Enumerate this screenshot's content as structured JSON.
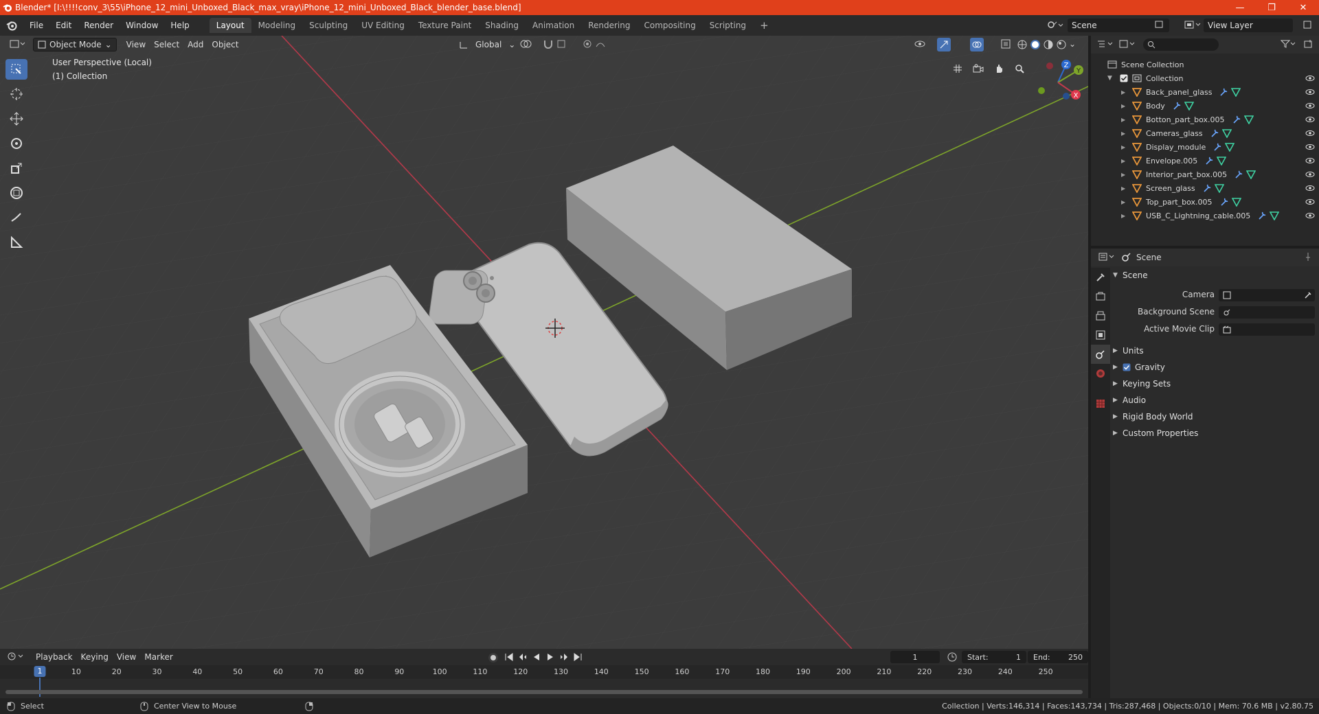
{
  "titlebar": {
    "title": "Blender* [I:\\!!!!conv_3\\55\\iPhone_12_mini_Unboxed_Black_max_vray\\iPhone_12_mini_Unboxed_Black_blender_base.blend]",
    "minimize": "—",
    "maximize": "❐",
    "close": "✕"
  },
  "menu": [
    "File",
    "Edit",
    "Render",
    "Window",
    "Help"
  ],
  "workspaces": [
    "Layout",
    "Modeling",
    "Sculpting",
    "UV Editing",
    "Texture Paint",
    "Shading",
    "Animation",
    "Rendering",
    "Compositing",
    "Scripting"
  ],
  "workspace_add": "+",
  "scene_name": "Scene",
  "view_layer": "View Layer",
  "viewport": {
    "mode": "Object Mode",
    "menus": [
      "View",
      "Select",
      "Add",
      "Object"
    ],
    "orientation": "Global",
    "info_line1": "User Perspective (Local)",
    "info_line2": "(1) Collection"
  },
  "gizmo": {
    "x": "X",
    "y": "Y",
    "z": "Z"
  },
  "outliner": {
    "search_placeholder": "",
    "scene_collection": "Scene Collection",
    "collection": "Collection",
    "objects": [
      "Back_panel_glass",
      "Body",
      "Botton_part_box.005",
      "Cameras_glass",
      "Display_module",
      "Envelope.005",
      "Interior_part_box.005",
      "Screen_glass",
      "Top_part_box.005",
      "USB_C_Lightning_cable.005"
    ]
  },
  "properties": {
    "header": "Scene",
    "section_scene": "Scene",
    "camera_label": "Camera",
    "background_label": "Background Scene",
    "movieclip_label": "Active Movie Clip",
    "sections": [
      "Units",
      "Gravity",
      "Keying Sets",
      "Audio",
      "Rigid Body World",
      "Custom Properties"
    ]
  },
  "timeline": {
    "menus": [
      "Playback",
      "Keying",
      "View",
      "Marker"
    ],
    "current_frame": "1",
    "start_label": "Start:",
    "start": "1",
    "end_label": "End:",
    "end": "250",
    "ticks": [
      "1",
      "10",
      "20",
      "30",
      "40",
      "50",
      "60",
      "70",
      "80",
      "90",
      "100",
      "110",
      "120",
      "130",
      "140",
      "150",
      "160",
      "170",
      "180",
      "190",
      "200",
      "210",
      "220",
      "230",
      "240",
      "250"
    ]
  },
  "statusbar": {
    "select": "Select",
    "center_view": "Center View to Mouse",
    "stats": "Collection | Verts:146,314 | Faces:143,734 | Tris:287,468 | Objects:0/10 | Mem: 70.6 MB | v2.80.75"
  },
  "colors": {
    "accent": "#4772b3",
    "titlebar": "#e0401b",
    "x_axis": "#b5394a",
    "y_axis": "#7ea52a"
  }
}
